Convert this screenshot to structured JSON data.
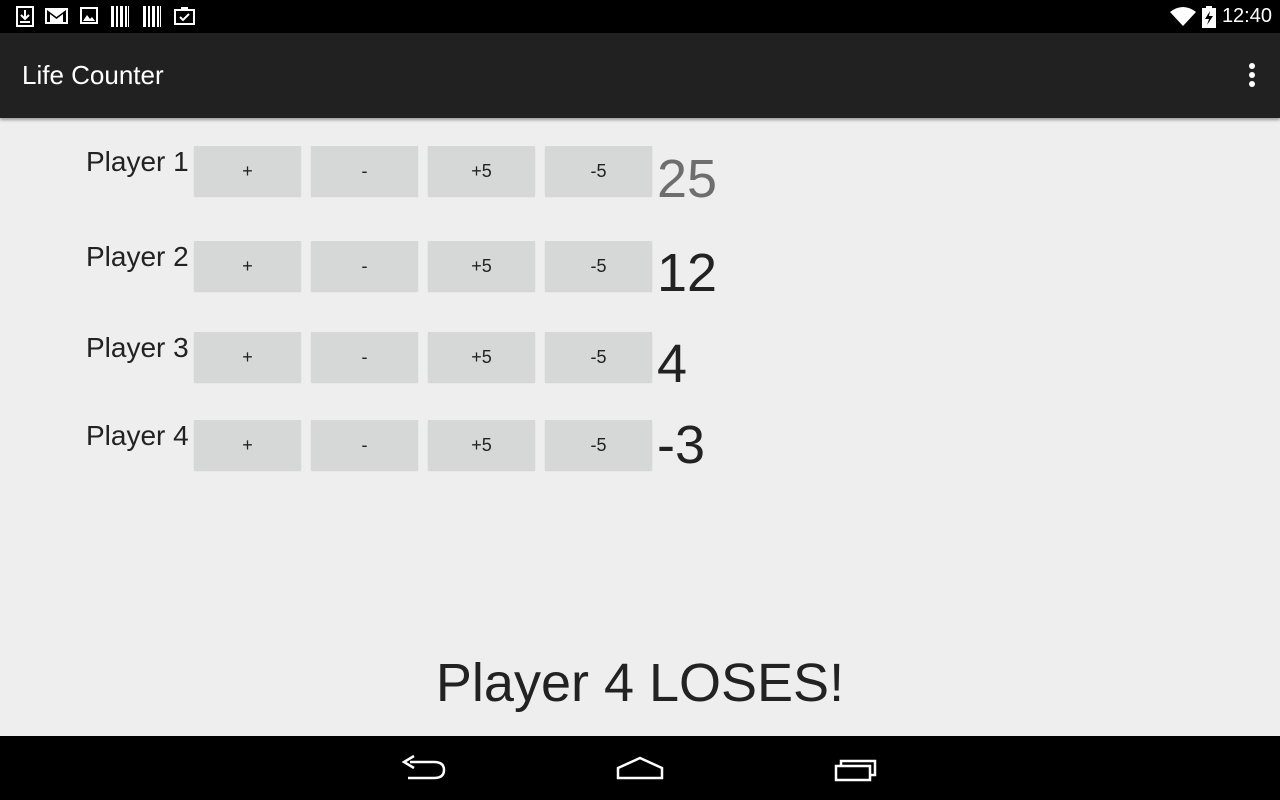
{
  "status_bar": {
    "time": "12:40",
    "notification_icons": [
      "download-icon",
      "gmail-icon",
      "image-icon",
      "barcode-icon",
      "barcode-icon",
      "clipboard-check-icon"
    ],
    "status_icons": [
      "wifi-icon",
      "battery-charging-icon"
    ]
  },
  "action_bar": {
    "title": "Life Counter",
    "overflow_icon": "more-vert-icon"
  },
  "players": [
    {
      "label": "Player 1",
      "life": "25",
      "buttons": {
        "plus": "+",
        "minus": "-",
        "plus5": "+5",
        "minus5": "-5"
      }
    },
    {
      "label": "Player 2",
      "life": "12",
      "buttons": {
        "plus": "+",
        "minus": "-",
        "plus5": "+5",
        "minus5": "-5"
      }
    },
    {
      "label": "Player 3",
      "life": "4",
      "buttons": {
        "plus": "+",
        "minus": "-",
        "plus5": "+5",
        "minus5": "-5"
      }
    },
    {
      "label": "Player 4",
      "life": "-3",
      "buttons": {
        "plus": "+",
        "minus": "-",
        "plus5": "+5",
        "minus5": "-5"
      }
    }
  ],
  "result": "Player 4 LOSES!",
  "nav_bar": {
    "icons": [
      "back-icon",
      "home-icon",
      "recent-apps-icon"
    ]
  },
  "colors": {
    "background": "#eeeeee",
    "action_bar": "#212121",
    "button": "#d6d7d7",
    "life_dim": "#6e6e6e"
  }
}
